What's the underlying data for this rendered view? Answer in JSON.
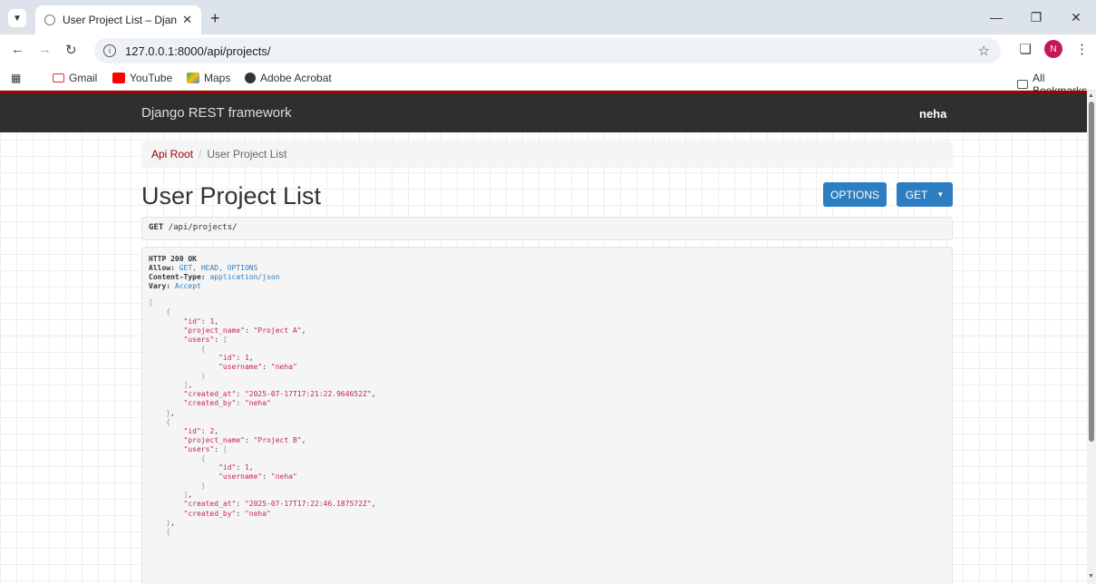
{
  "browser": {
    "tab_title": "User Project List – Django REST",
    "url": "127.0.0.1:8000/api/projects/",
    "profile_initial": "N",
    "bookmarks": [
      "Gmail",
      "YouTube",
      "Maps",
      "Adobe Acrobat"
    ],
    "all_bookmarks": "All Bookmarks"
  },
  "navbar": {
    "brand": "Django REST framework",
    "user": "neha"
  },
  "breadcrumb": {
    "root": "Api Root",
    "separator": "/",
    "current": "User Project List"
  },
  "page": {
    "title": "User Project List",
    "options_label": "OPTIONS",
    "get_label": "GET"
  },
  "request": {
    "method": "GET",
    "path": "/api/projects/"
  },
  "response": {
    "status": "HTTP 200 OK",
    "headers": [
      {
        "name": "Allow:",
        "value": "GET, HEAD, OPTIONS"
      },
      {
        "name": "Content-Type:",
        "value": "application/json"
      },
      {
        "name": "Vary:",
        "value": "Accept"
      }
    ],
    "projects": [
      {
        "id": "1",
        "project_name": "\"Project A\"",
        "user_id": "1",
        "username": "\"neha\"",
        "created_at": "\"2025-07-17T17:21:22.964652Z\"",
        "created_by": "\"neha\""
      },
      {
        "id": "2",
        "project_name": "\"Project B\"",
        "user_id": "1",
        "username": "\"neha\"",
        "created_at": "\"2025-07-17T17:22:46.187572Z\"",
        "created_by": "\"neha\""
      }
    ]
  },
  "colors": {
    "brand_red": "#a30000",
    "button_blue": "#2c7ec0",
    "navbar_bg": "#2f2f2f",
    "json_string": "#c7254e"
  }
}
